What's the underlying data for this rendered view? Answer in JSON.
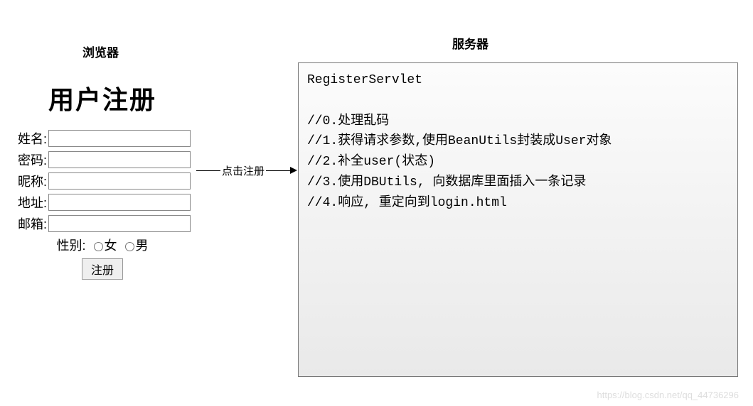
{
  "labels": {
    "browser": "浏览器",
    "server": "服务器",
    "title": "用户注册",
    "name": "姓名:",
    "password": "密码:",
    "nickname": "昵称:",
    "address": "地址:",
    "email": "邮箱:",
    "gender": "性别:",
    "female": "女",
    "male": "男",
    "submit": "注册",
    "arrow": "点击注册"
  },
  "servlet": {
    "title": "RegisterServlet",
    "lines": [
      "//0.处理乱码",
      "//1.获得请求参数,使用BeanUtils封装成User对象",
      "//2.补全user(状态)",
      "//3.使用DBUtils, 向数据库里面插入一条记录",
      "//4.响应, 重定向到login.html"
    ]
  },
  "watermark": "https://blog.csdn.net/qq_44736296"
}
